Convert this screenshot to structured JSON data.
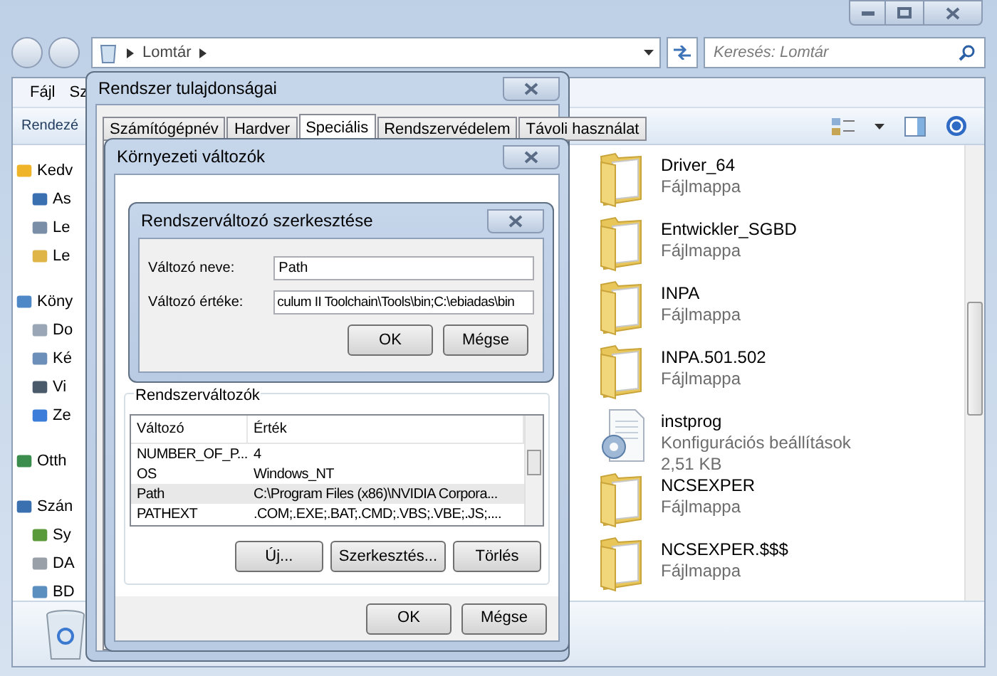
{
  "explorer": {
    "address_path": "Lomtár",
    "search": {
      "placeholder": "Keresés: Lomtár"
    },
    "menu": [
      "Fájl",
      "Sz"
    ],
    "toolbar_label": "Rendezé",
    "sidebar": [
      {
        "label": "Kedv",
        "children": [
          {
            "label": "As"
          },
          {
            "label": "Le"
          },
          {
            "label": "Le"
          }
        ]
      },
      {
        "label": "Köny",
        "children": [
          {
            "label": "Do"
          },
          {
            "label": "Ké"
          },
          {
            "label": "Vi"
          },
          {
            "label": "Ze"
          }
        ]
      },
      {
        "label": "Otth"
      },
      {
        "label": "Szán",
        "children": [
          {
            "label": "Sy"
          },
          {
            "label": "DA"
          },
          {
            "label": "BD"
          }
        ]
      }
    ],
    "files": [
      {
        "kind": "folder",
        "name": "Driver_64",
        "type": "Fájlmappa"
      },
      {
        "kind": "folder",
        "name": "Entwickler_SGBD",
        "type": "Fájlmappa"
      },
      {
        "kind": "folder",
        "name": "INPA",
        "type": "Fájlmappa"
      },
      {
        "kind": "folder",
        "name": "INPA.501.502",
        "type": "Fájlmappa"
      },
      {
        "kind": "config",
        "name": "instprog",
        "type": "Konfigurációs beállítások",
        "size": "2,51 KB"
      },
      {
        "kind": "folder",
        "name": "NCSEXPER",
        "type": "Fájlmappa"
      },
      {
        "kind": "folder",
        "name": "NCSEXPER.$$$",
        "type": "Fájlmappa"
      }
    ]
  },
  "system_properties": {
    "title": "Rendszer tulajdonságai",
    "tabs": [
      {
        "label": "Számítógépnév",
        "selected": false
      },
      {
        "label": "Hardver",
        "selected": false
      },
      {
        "label": "Speciális",
        "selected": true
      },
      {
        "label": "Rendszervédelem",
        "selected": false
      },
      {
        "label": "Távoli használat",
        "selected": false
      }
    ]
  },
  "environment_variables": {
    "title": "Környezeti változók",
    "system_group": {
      "title": "Rendszerváltozók",
      "columns": [
        "Változó",
        "Érték"
      ],
      "rows": [
        {
          "variable": "NUMBER_OF_P...",
          "value": "4",
          "selected": false
        },
        {
          "variable": "OS",
          "value": "Windows_NT",
          "selected": false
        },
        {
          "variable": "Path",
          "value": "C:\\Program Files (x86)\\NVIDIA Corpora...",
          "selected": true
        },
        {
          "variable": "PATHEXT",
          "value": ".COM;.EXE;.BAT;.CMD;.VBS;.VBE;.JS;....",
          "selected": false
        }
      ],
      "buttons": [
        "Új...",
        "Szerkesztés...",
        "Törlés"
      ]
    },
    "buttons": [
      "OK",
      "Mégse"
    ]
  },
  "edit_variable": {
    "title": "Rendszerváltozó szerkesztése",
    "name_label": "Változó neve:",
    "name_value": "Path",
    "value_label": "Változó értéke:",
    "value_value": "culum II Toolchain\\Tools\\bin;C:\\ebiadas\\bin",
    "buttons": [
      "OK",
      "Mégse"
    ]
  }
}
